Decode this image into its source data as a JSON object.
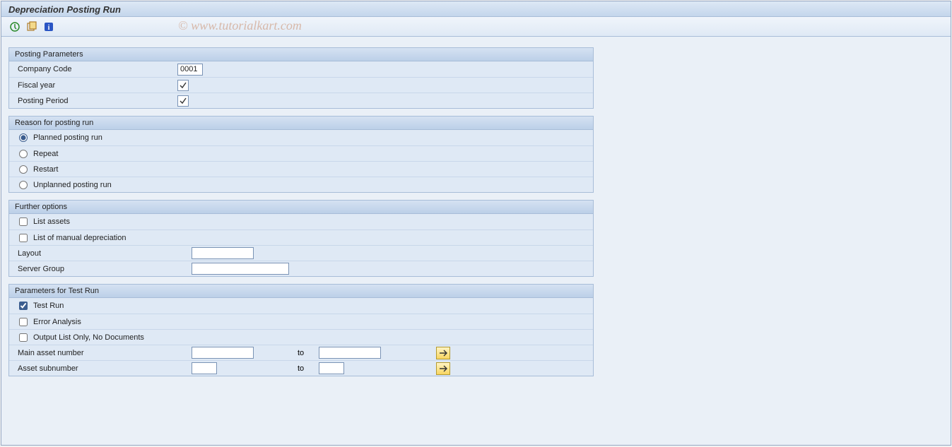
{
  "title": "Depreciation Posting Run",
  "watermark": "© www.tutorialkart.com",
  "groups": {
    "posting": {
      "header": "Posting Parameters",
      "company_code_label": "Company Code",
      "company_code_value": "0001",
      "fiscal_year_label": "Fiscal year",
      "posting_period_label": "Posting Period"
    },
    "reason": {
      "header": "Reason for posting run",
      "opt_planned": "Planned posting run",
      "opt_repeat": "Repeat",
      "opt_restart": "Restart",
      "opt_unplanned": "Unplanned posting run"
    },
    "further": {
      "header": "Further options",
      "list_assets": "List assets",
      "list_manual": "List of manual depreciation",
      "layout_label": "Layout",
      "server_group_label": "Server Group"
    },
    "testrun": {
      "header": "Parameters for Test Run",
      "test_run": "Test Run",
      "error_analysis": "Error Analysis",
      "output_only": "Output List Only, No Documents",
      "main_asset_label": "Main asset number",
      "asset_sub_label": "Asset subnumber",
      "to_label": "to"
    }
  }
}
